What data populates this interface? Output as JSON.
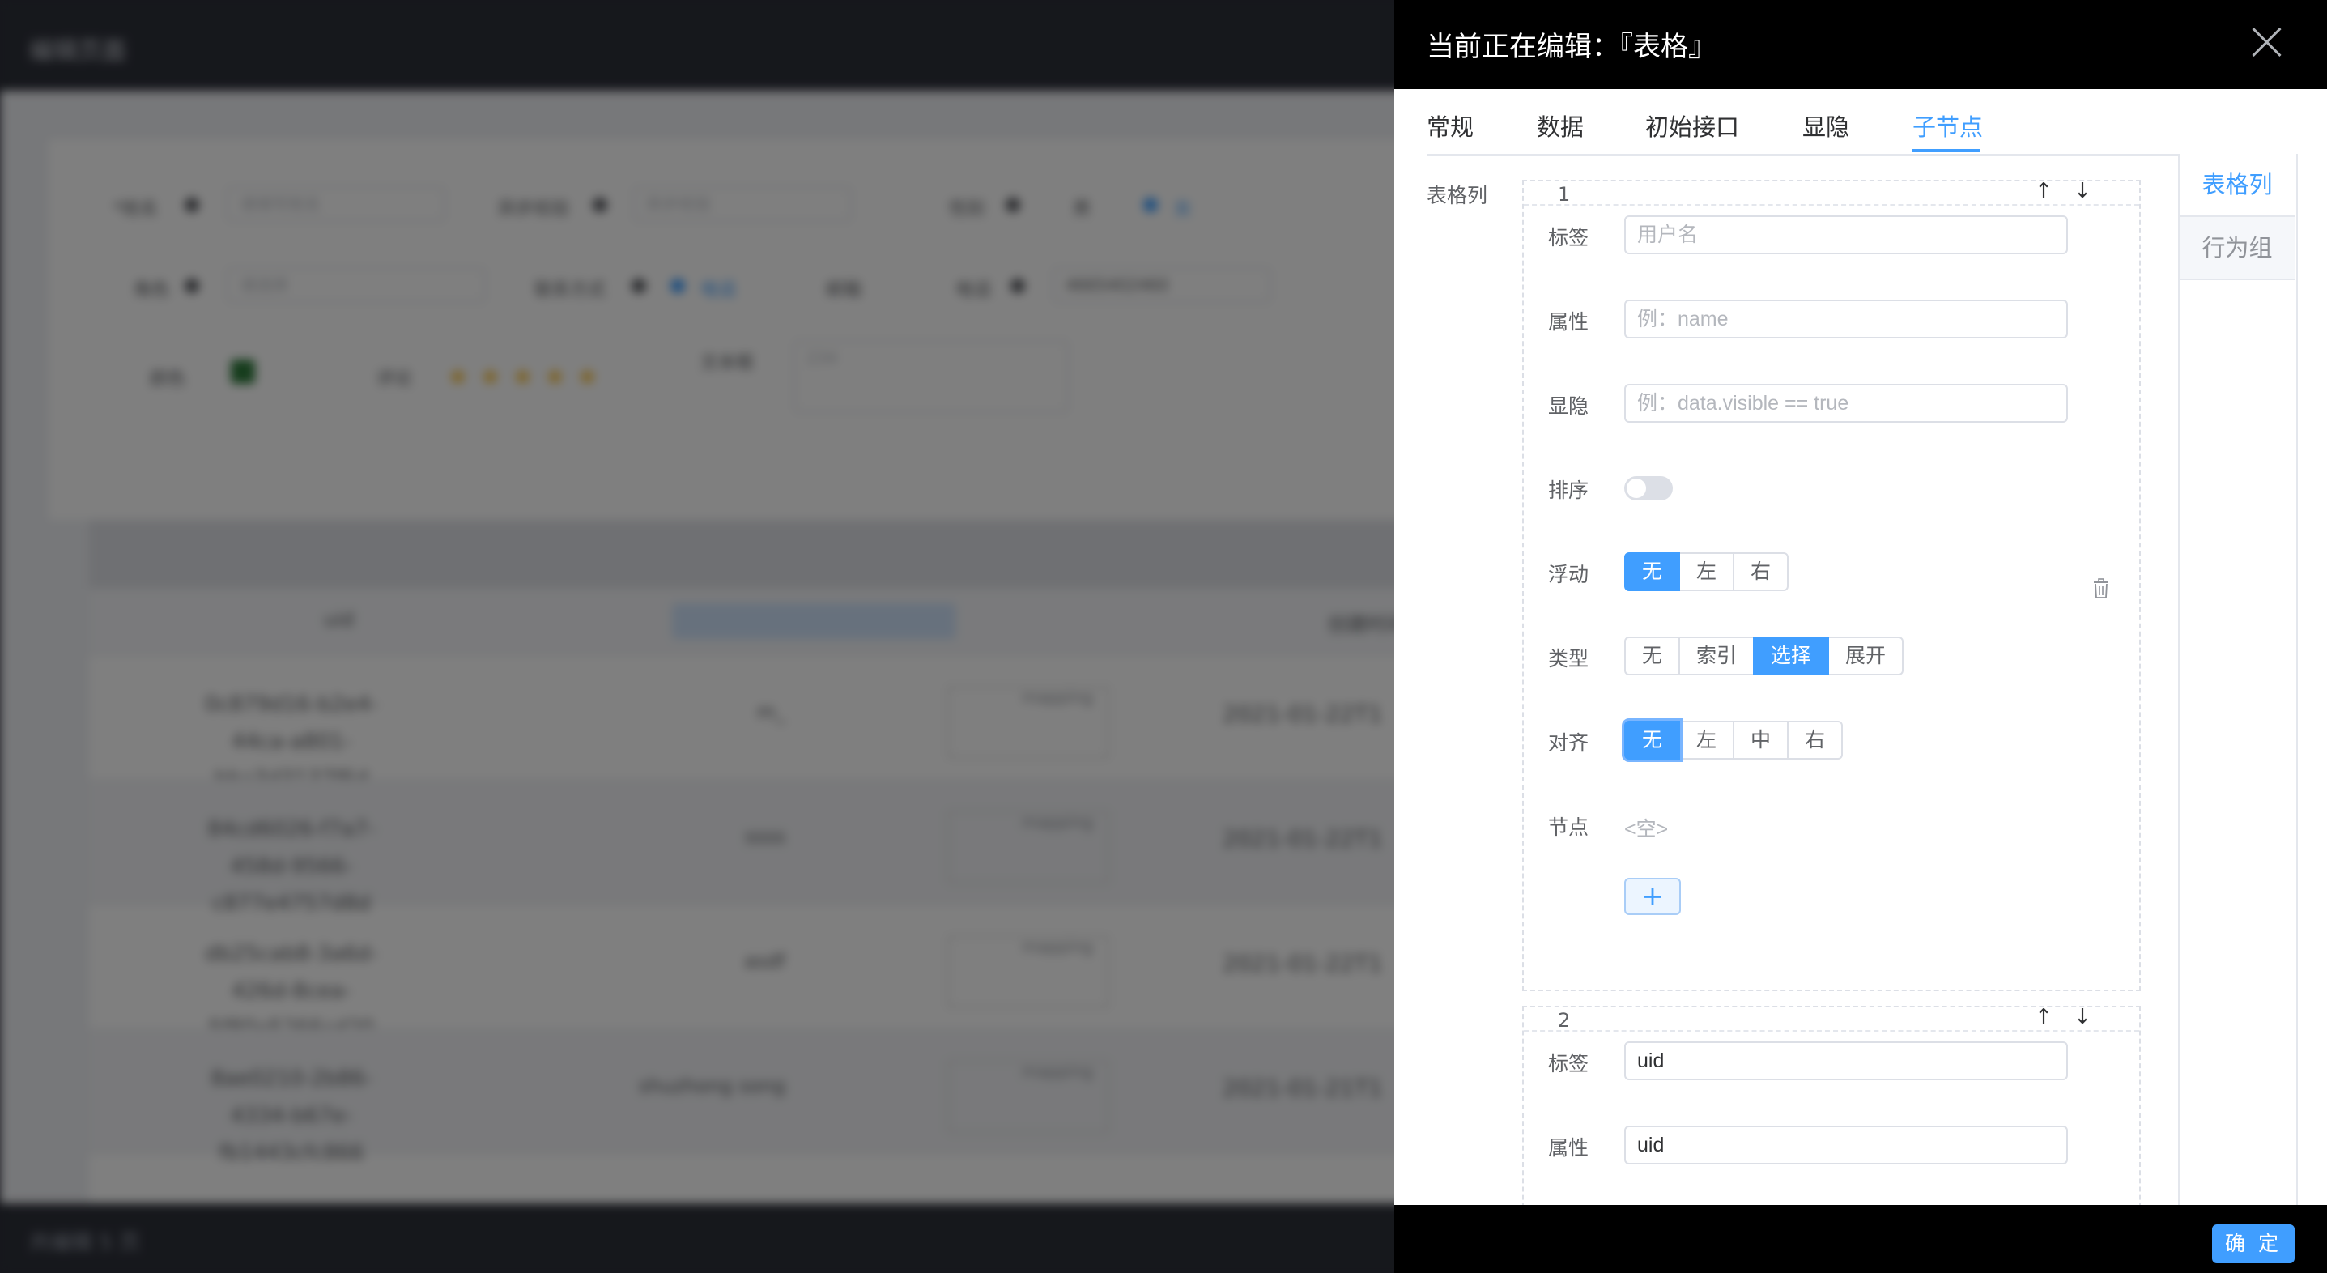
{
  "background_page": {
    "header_title": "编辑页面",
    "footer_text": "共编辑 5 页",
    "form": {
      "fields": [
        {
          "label": "*姓名",
          "placeholder": "请填写姓名"
        },
        {
          "label": "异步校验",
          "placeholder": "异步校验"
        },
        {
          "label": "性别",
          "options": [
            "男",
            "女"
          ]
        },
        {
          "label": "角色",
          "placeholder": "请选择"
        },
        {
          "label": "联系方式",
          "options": [
            "电话",
            "邮箱"
          ]
        },
        {
          "label": "电话",
          "value": "4665402460"
        },
        {
          "label": "颜色"
        },
        {
          "label": "评论"
        },
        {
          "label": "文本框",
          "value": "234"
        }
      ]
    },
    "table": {
      "header": [
        "uid",
        "",
        "",
        "创建时间"
      ],
      "rows": [
        {
          "uid": "0c879d16-b2e4-44ca-a801-bba3d3137f6d",
          "name": "m_",
          "tag": "mapping",
          "time": "2021-01-22T1"
        },
        {
          "uid": "84cd6026-f7a7-458d-9566-c877e4757d8d",
          "name": "ssss",
          "tag": "mapping",
          "time": "2021-01-22T1"
        },
        {
          "uid": "db25cab8-3a6d-426d-8cea-5f80e5266cd20",
          "name": "asdf",
          "tag": "mapping",
          "time": "2021-01-22T1"
        },
        {
          "uid": "8ae0210-2b86-4334-b67e-fb1443cfc866",
          "name": "shuzhong song",
          "tag": "mapping",
          "time": "2021-01-21T1"
        }
      ]
    }
  },
  "drawer": {
    "title": "当前正在编辑：『表格』",
    "tabs": [
      "常规",
      "数据",
      "初始接口",
      "显隐",
      "子节点"
    ],
    "active_tab": "子节点",
    "section_label": "表格列",
    "side_tabs": [
      "表格列",
      "行为组"
    ],
    "active_side_tab": "表格列",
    "cards": [
      {
        "index": "1",
        "label_text": "标签",
        "label_placeholder": "用户名",
        "prop_text": "属性",
        "prop_placeholder": "例：name",
        "visible_text": "显隐",
        "visible_placeholder": "例：data.visible == true",
        "sort_text": "排序",
        "sort_on": false,
        "float_text": "浮动",
        "float_options": [
          "无",
          "左",
          "右"
        ],
        "float_selected": "无",
        "type_text": "类型",
        "type_options": [
          "无",
          "索引",
          "选择",
          "展开"
        ],
        "type_selected": "选择",
        "align_text": "对齐",
        "align_options": [
          "无",
          "左",
          "中",
          "右"
        ],
        "align_selected": "无",
        "node_text": "节点",
        "node_value": "<空>",
        "add_label": "+"
      },
      {
        "index": "2",
        "label_text": "标签",
        "label_value": "uid",
        "prop_text": "属性",
        "prop_value": "uid"
      }
    ],
    "up_arrow": "↑",
    "down_arrow": "↓",
    "confirm_label": "确 定"
  },
  "colors": {
    "accent": "#409eff",
    "drawer_header": "#000000",
    "overlay": "rgba(0,0,0,0.5)"
  }
}
